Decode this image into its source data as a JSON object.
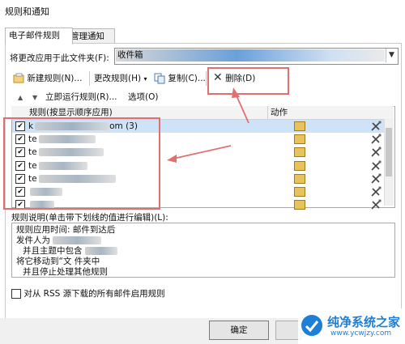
{
  "window": {
    "title": "规则和通知"
  },
  "tabs": [
    {
      "label": "电子邮件规则",
      "active": true
    },
    {
      "label": "管理通知",
      "active": false
    }
  ],
  "apply_folder": {
    "label": "将更改应用于此文件夹(F):",
    "value": "收件箱 "
  },
  "toolbar": {
    "new_rule": "新建规则(N)...",
    "change_rule": "更改规则(H)",
    "copy": "复制(C)...",
    "delete": "删除(D)"
  },
  "row2": {
    "run_now": "立即运行规则(R)...",
    "options": "选项(O)"
  },
  "list": {
    "col_rule": "规则(按显示顺序应用)",
    "col_action": "动作",
    "rows": [
      {
        "name_prefix": "k",
        "name_suffix": "om (3)",
        "checked": true,
        "selected": true
      },
      {
        "name_prefix": "te",
        "name_suffix": "",
        "checked": true,
        "selected": false
      },
      {
        "name_prefix": "te",
        "name_suffix": "",
        "checked": true,
        "selected": false
      },
      {
        "name_prefix": "te",
        "name_suffix": "",
        "checked": true,
        "selected": false
      },
      {
        "name_prefix": "te",
        "name_suffix": "",
        "checked": true,
        "selected": false
      },
      {
        "name_prefix": "",
        "name_suffix": "",
        "checked": true,
        "selected": false
      },
      {
        "name_prefix": "",
        "name_suffix": "",
        "checked": true,
        "selected": false
      }
    ]
  },
  "description": {
    "label": "规则说明(单击带下划线的值进行编辑)(L):",
    "lines": [
      "规则应用时间: 邮件到达后",
      "发件人为 ",
      "并且主题中包含 ",
      "将它移动到“文 件夹中",
      "并且停止处理其他规则"
    ]
  },
  "rss": {
    "label": "对从 RSS 源下载的所有邮件启用规则"
  },
  "buttons": {
    "ok": "确定"
  },
  "watermark": {
    "text": "纯净系统之家",
    "url": "www.ycwjzy.com"
  },
  "colors": {
    "selection": "#cfe3f8",
    "annotation": "#e07070",
    "folder_highlight": "#6aa0d9"
  }
}
